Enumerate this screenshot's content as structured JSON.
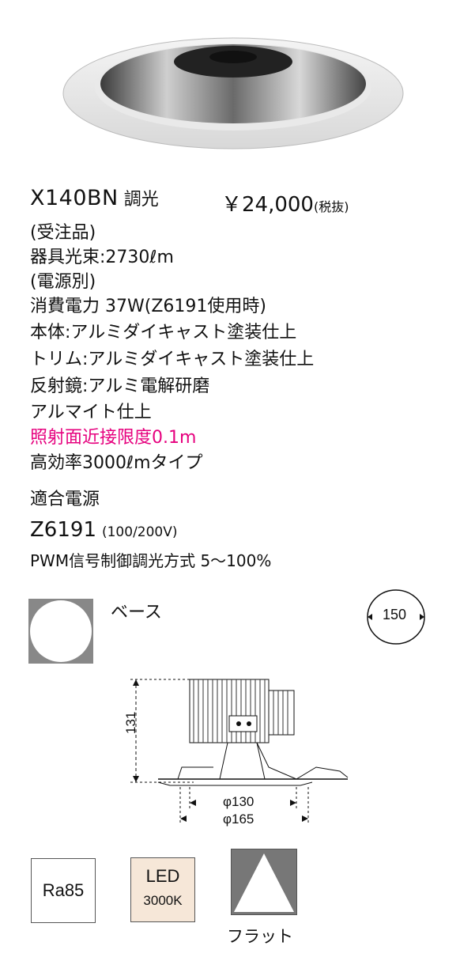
{
  "product": {
    "model": "X140BN",
    "model_suffix": "調光",
    "price": "￥24,000",
    "price_note": "(税抜)",
    "order_note": "(受注品)",
    "lumen": "器具光束:2730ℓm",
    "power_note": "(電源別)",
    "power": "消費電力 37W(Z6191使用時)",
    "body": "本体:アルミダイキャスト塗装仕上",
    "trim": "トリム:アルミダイキャスト塗装仕上",
    "reflector": "反射鏡:アルミ電解研磨",
    "reflector2": "アルマイト仕上",
    "distance": "照射面近接限度0.1m",
    "type": "高効率3000ℓmタイプ",
    "power_supply_label": "適合電源",
    "power_supply_model": "Z6191",
    "power_supply_voltage": "(100/200V)",
    "dimming": "PWM信号制御調光方式 5〜100%"
  },
  "base": {
    "label": "ベース"
  },
  "cutout": {
    "value": "150"
  },
  "dimensions": {
    "height": "131",
    "inner_diameter": "φ130",
    "outer_diameter": "φ165"
  },
  "badges": {
    "ra": "Ra85",
    "led_label": "LED",
    "led_temp": "3000K",
    "beam_label": "フラット"
  },
  "colors": {
    "accent_pink": "#e6007e",
    "led_badge_bg": "#f6e7d8"
  }
}
